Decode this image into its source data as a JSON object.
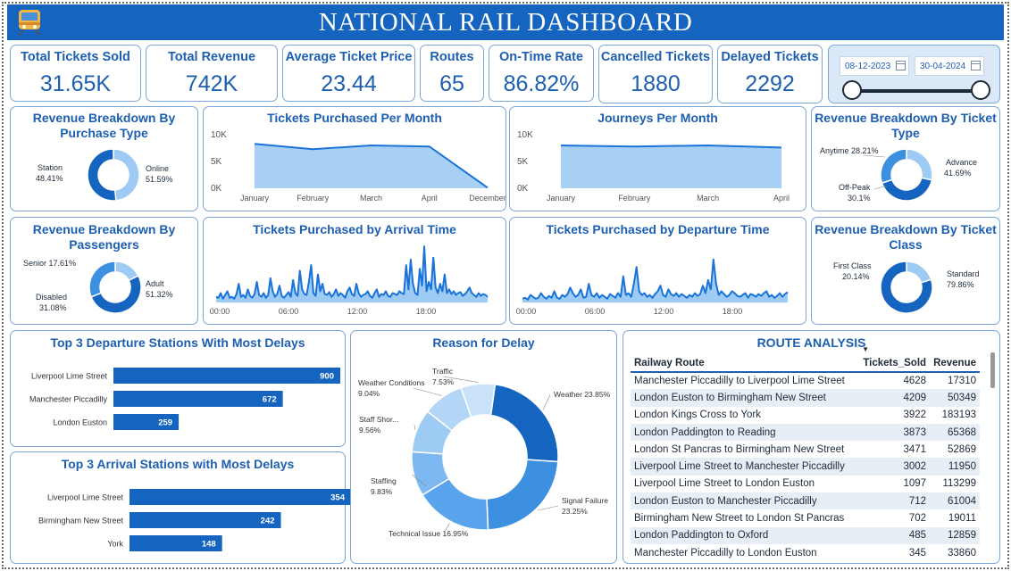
{
  "header": {
    "title": "NATIONAL RAIL DASHBOARD"
  },
  "kpis": [
    {
      "label": "Total Tickets Sold",
      "value": "31.65K"
    },
    {
      "label": "Total Revenue",
      "value": "742K"
    },
    {
      "label": "Average Ticket Price",
      "value": "23.44"
    },
    {
      "label": "Routes",
      "value": "65"
    },
    {
      "label": "On-Time Rate",
      "value": "86.82%"
    },
    {
      "label": "Cancelled Tickets",
      "value": "1880"
    },
    {
      "label": "Delayed Tickets",
      "value": "2292"
    }
  ],
  "date_slicer": {
    "start": "08-12-2023",
    "end": "30-04-2024"
  },
  "panels": {
    "purchase_type": {
      "title": "Revenue Breakdown By Purchase Type",
      "labels": [
        [
          "Station",
          "48.41%"
        ],
        [
          "Online",
          "51.59%"
        ]
      ]
    },
    "ticket_type": {
      "title": "Revenue Breakdown By Ticket Type",
      "labels": [
        [
          "Anytime 28.21%"
        ],
        [
          "Advance",
          "41.69%"
        ],
        [
          "Off-Peak",
          "30.1%"
        ]
      ]
    },
    "passengers": {
      "title": "Revenue Breakdown By Passengers",
      "labels": [
        [
          "Senior 17.61%"
        ],
        [
          "Adult",
          "51.32%"
        ],
        [
          "Disabled",
          "31.08%"
        ]
      ]
    },
    "ticket_class": {
      "title": "Revenue Breakdown By Ticket Class",
      "labels": [
        [
          "First Class",
          "20.14%"
        ],
        [
          "Standard",
          "79.86%"
        ]
      ]
    },
    "tickets_month": {
      "title": "Tickets Purchased Per Month"
    },
    "journeys_month": {
      "title": "Journeys Per Month"
    },
    "arrival_time": {
      "title": "Tickets Purchased by Arrival Time"
    },
    "departure_time": {
      "title": "Tickets Purchased by Departure Time"
    },
    "dep_delays": {
      "title": "Top 3 Departure Stations With Most Delays"
    },
    "arr_delays": {
      "title": "Top 3 Arrival Stations with Most Delays"
    },
    "delay_reason": {
      "title": "Reason for Delay"
    },
    "routes": {
      "title": "ROUTE ANALYSIS"
    }
  },
  "chart_data": [
    {
      "type": "pie",
      "id": "purchase_type",
      "labels": [
        "Station",
        "Online"
      ],
      "values": [
        48.41,
        51.59
      ],
      "colors": [
        "#9ecbf3",
        "#1565c0"
      ]
    },
    {
      "type": "pie",
      "id": "ticket_type",
      "labels": [
        "Anytime",
        "Advance",
        "Off-Peak"
      ],
      "values": [
        28.21,
        41.69,
        30.1
      ],
      "colors": [
        "#9ecbf3",
        "#1565c0",
        "#3d8fe0"
      ]
    },
    {
      "type": "pie",
      "id": "passengers",
      "labels": [
        "Senior",
        "Adult",
        "Disabled"
      ],
      "values": [
        17.61,
        51.32,
        31.08
      ],
      "colors": [
        "#9ecbf3",
        "#1565c0",
        "#3d8fe0"
      ]
    },
    {
      "type": "pie",
      "id": "ticket_class",
      "labels": [
        "First Class",
        "Standard"
      ],
      "values": [
        20.14,
        79.86
      ],
      "colors": [
        "#9ecbf3",
        "#1565c0"
      ]
    },
    {
      "type": "area",
      "id": "tickets_month",
      "categories": [
        "January",
        "February",
        "March",
        "April",
        "December"
      ],
      "values": [
        8300,
        7300,
        8000,
        7800,
        100
      ],
      "y_ticks": [
        "0K",
        "5K",
        "10K"
      ],
      "ylim": [
        0,
        10000
      ]
    },
    {
      "type": "area",
      "id": "journeys_month",
      "categories": [
        "January",
        "February",
        "March",
        "April"
      ],
      "values": [
        8000,
        7800,
        8000,
        7600
      ],
      "y_ticks": [
        "0K",
        "5K",
        "10K"
      ],
      "ylim": [
        0,
        10000
      ]
    },
    {
      "type": "area",
      "id": "arrival_time",
      "x_ticks": [
        "00:00",
        "06:00",
        "12:00",
        "18:00"
      ],
      "values": [
        6,
        5,
        10,
        4,
        8,
        12,
        5,
        6,
        4,
        9,
        20,
        6,
        8,
        5,
        14,
        7,
        5,
        9,
        22,
        8,
        6,
        10,
        5,
        8,
        26,
        12,
        6,
        9,
        18,
        7,
        5,
        8,
        11,
        6,
        24,
        10,
        7,
        34,
        14,
        9,
        8,
        22,
        40,
        10,
        7,
        30,
        12,
        20,
        9,
        8,
        11,
        6,
        9,
        14,
        7,
        10,
        8,
        5,
        12,
        16,
        9,
        7,
        20,
        10,
        6,
        8,
        9,
        12,
        7,
        5,
        10,
        14,
        6,
        9,
        8,
        12,
        7,
        6,
        10,
        9,
        8,
        12,
        10,
        9,
        40,
        14,
        46,
        20,
        10,
        8,
        36,
        18,
        60,
        12,
        22,
        14,
        48,
        16,
        10,
        20,
        12,
        30,
        10,
        14,
        9,
        12,
        8,
        10,
        11,
        7,
        9,
        12,
        16,
        10,
        8,
        6,
        10,
        7,
        9,
        8,
        6
      ],
      "ylim": [
        0,
        64
      ]
    },
    {
      "type": "area",
      "id": "departure_time",
      "x_ticks": [
        "00:00",
        "06:00",
        "12:00",
        "18:00"
      ],
      "values": [
        4,
        5,
        3,
        8,
        6,
        4,
        5,
        10,
        6,
        4,
        7,
        5,
        12,
        5,
        4,
        8,
        6,
        9,
        16,
        10,
        6,
        8,
        14,
        5,
        6,
        20,
        8,
        6,
        10,
        5,
        8,
        6,
        4,
        9,
        7,
        5,
        10,
        6,
        28,
        8,
        10,
        6,
        20,
        38,
        12,
        8,
        10,
        6,
        8,
        5,
        9,
        12,
        18,
        8,
        6,
        14,
        9,
        7,
        10,
        6,
        9,
        7,
        5,
        8,
        6,
        10,
        7,
        9,
        18,
        10,
        24,
        14,
        46,
        20,
        8,
        12,
        9,
        6,
        8,
        12,
        10,
        7,
        6,
        8,
        10,
        5,
        9,
        8,
        6,
        9,
        7,
        10,
        12,
        6,
        8,
        5,
        7,
        10,
        6,
        9,
        11
      ],
      "ylim": [
        0,
        64
      ]
    },
    {
      "type": "bar",
      "id": "dep_delays",
      "categories": [
        "Liverpool Lime Street",
        "Manchester Piccadilly",
        "London Euston"
      ],
      "values": [
        900,
        672,
        259
      ]
    },
    {
      "type": "bar",
      "id": "arr_delays",
      "categories": [
        "Liverpool Lime Street",
        "Birmingham New Street",
        "York"
      ],
      "values": [
        354,
        242,
        148
      ]
    },
    {
      "type": "pie",
      "id": "delay_reason",
      "labels": [
        "Weather",
        "Signal Failure",
        "Technical Issue",
        "Staffing",
        "Staff Shortage",
        "Weather Conditions",
        "Traffic"
      ],
      "display_labels": [
        [
          "Weather 23.85%"
        ],
        [
          "Signal Failure",
          "23.25%"
        ],
        [
          "Technical Issue 16.95%"
        ],
        [
          "Staffing",
          "9.83%"
        ],
        [
          "Staff Shor...",
          "9.56%"
        ],
        [
          "Weather Conditions",
          "9.04%"
        ],
        [
          "Traffic",
          "7.53%"
        ]
      ],
      "values": [
        23.85,
        23.25,
        16.95,
        9.83,
        9.56,
        9.04,
        7.53
      ],
      "colors": [
        "#1565c0",
        "#3d8fe0",
        "#5aa4ee",
        "#7db8f2",
        "#9ecbf3",
        "#b4d6f6",
        "#c9e2f9"
      ]
    }
  ],
  "route_table": {
    "headers": [
      "Railway Route",
      "Tickets_Sold",
      "Revenue"
    ],
    "rows": [
      [
        "Manchester Piccadilly to Liverpool Lime Street",
        "4628",
        "17310"
      ],
      [
        "London Euston to Birmingham New Street",
        "4209",
        "50349"
      ],
      [
        "London Kings Cross to York",
        "3922",
        "183193"
      ],
      [
        "London Paddington to Reading",
        "3873",
        "65368"
      ],
      [
        "London St Pancras to Birmingham New Street",
        "3471",
        "52869"
      ],
      [
        "Liverpool Lime Street to Manchester Piccadilly",
        "3002",
        "11950"
      ],
      [
        "Liverpool Lime Street to London Euston",
        "1097",
        "113299"
      ],
      [
        "London Euston to Manchester Piccadilly",
        "712",
        "61004"
      ],
      [
        "Birmingham New Street to London St Pancras",
        "702",
        "19011"
      ],
      [
        "London Paddington to Oxford",
        "485",
        "12859"
      ],
      [
        "Manchester Piccadilly to London Euston",
        "345",
        "33860"
      ]
    ]
  }
}
